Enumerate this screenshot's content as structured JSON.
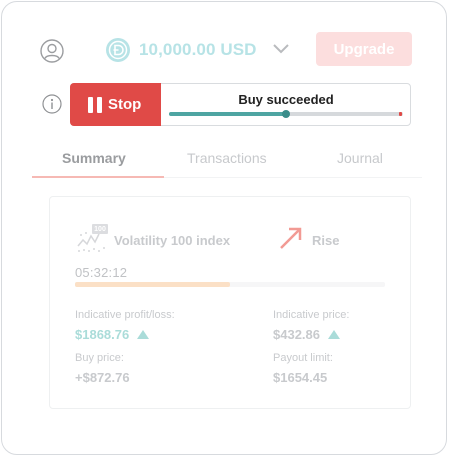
{
  "header": {
    "balance": "10,000.00 USD",
    "upgrade_label": "Upgrade"
  },
  "trade": {
    "stop_label": "Stop",
    "status": "Buy succeeded",
    "progress": 0.5
  },
  "tabs": [
    {
      "label": "Summary",
      "active": true
    },
    {
      "label": "Transactions",
      "active": false
    },
    {
      "label": "Journal",
      "active": false
    }
  ],
  "card": {
    "asset_badge": "100",
    "asset_name": "Volatility 100 index",
    "direction": "Rise",
    "timer": "05:32:12",
    "timer_progress": 0.5,
    "fields": {
      "profit_label": "Indicative profit/loss:",
      "profit_value": "$1868.76",
      "price_label": "Indicative price:",
      "price_value": "$432.86",
      "buy_label": "Buy price:",
      "buy_value": "+$872.76",
      "payout_label": "Payout limit:",
      "payout_value": "$1654.45"
    }
  },
  "colors": {
    "stop": "#e04a47",
    "progress": "#4ea5a2",
    "upgrade": "#fcdede",
    "balance": "#b7e3e6",
    "rise_arrow": "#f29a94",
    "positive": "#aadcd9",
    "timer_fill": "#fbe0c6"
  },
  "icons": {
    "user": "user-icon",
    "coin": "coin-icon",
    "chevron": "chevron-down-icon",
    "info": "info-icon",
    "pause": "pause-icon",
    "asset": "volatility-icon",
    "rise": "rise-arrow-icon",
    "trend_up": "up-triangle-icon"
  }
}
